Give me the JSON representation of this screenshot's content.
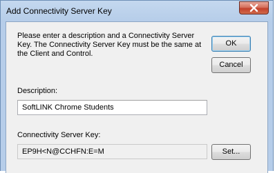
{
  "window": {
    "title": "Add Connectivity Server Key"
  },
  "prompt": "Please enter a description and a Connectivity Server Key. The Connectivity Server Key must be the same at the Client and Control.",
  "buttons": {
    "ok": "OK",
    "cancel": "Cancel",
    "set": "Set..."
  },
  "description": {
    "label": "Description:",
    "value": "SoftLINK Chrome Students"
  },
  "server_key": {
    "label": "Connectivity Server Key:",
    "value": "EP9H<N@CCHFN:E=M"
  },
  "icons": {
    "close": "close-icon"
  },
  "colors": {
    "close_button": "#c4412c",
    "title_bar": "#c4d8ef",
    "dialog_bg": "#f0f0f0"
  }
}
